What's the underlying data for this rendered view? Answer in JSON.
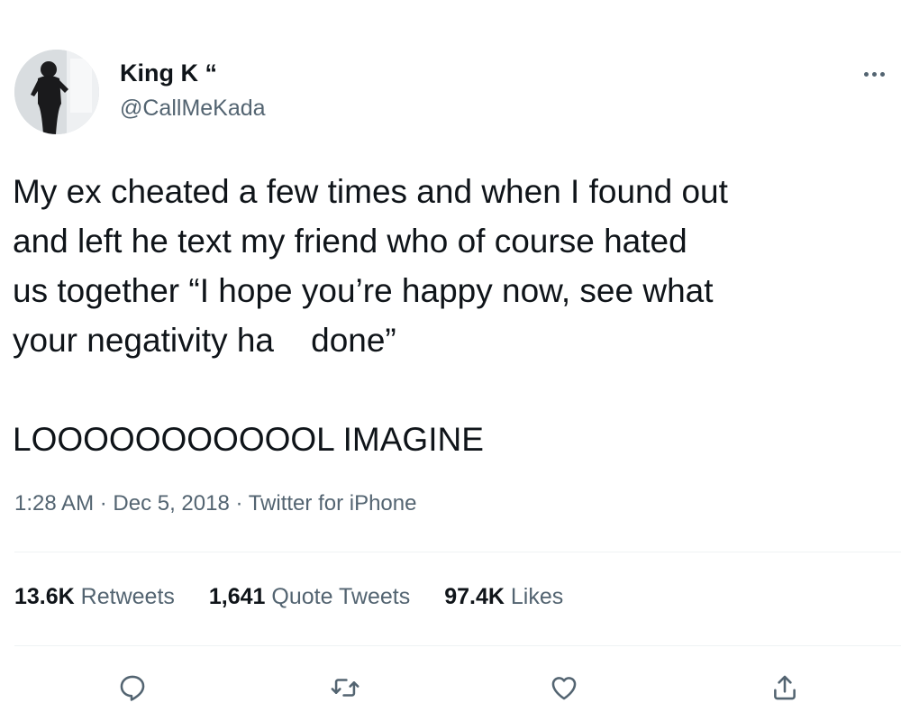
{
  "author": {
    "display_name": "King K “",
    "handle": "@CallMeKada",
    "avatar": "profile-photo"
  },
  "tweet": {
    "lines": [
      "My ex cheated a few times and when I found out",
      "and left he text my friend who of course hated",
      "us together “I hope you’re happy now, see what",
      "your negativity ha    done”"
    ],
    "second_paragraph": "LOOOOOOOOOOOL IMAGINE"
  },
  "meta": {
    "time": "1:28 AM",
    "separator": " · ",
    "date": "Dec 5, 2018",
    "source": "Twitter for iPhone"
  },
  "stats": {
    "retweets": {
      "count": "13.6K",
      "label": "Retweets"
    },
    "quote_tweets": {
      "count": "1,641",
      "label": "Quote Tweets"
    },
    "likes": {
      "count": "97.4K",
      "label": "Likes"
    }
  },
  "icons": {
    "more": "more-icon",
    "reply": "reply-icon",
    "retweet": "retweet-icon",
    "like": "heart-icon",
    "share": "share-icon"
  },
  "colors": {
    "text_primary": "#0f1419",
    "text_secondary": "#536471",
    "divider": "#eff3f4"
  }
}
